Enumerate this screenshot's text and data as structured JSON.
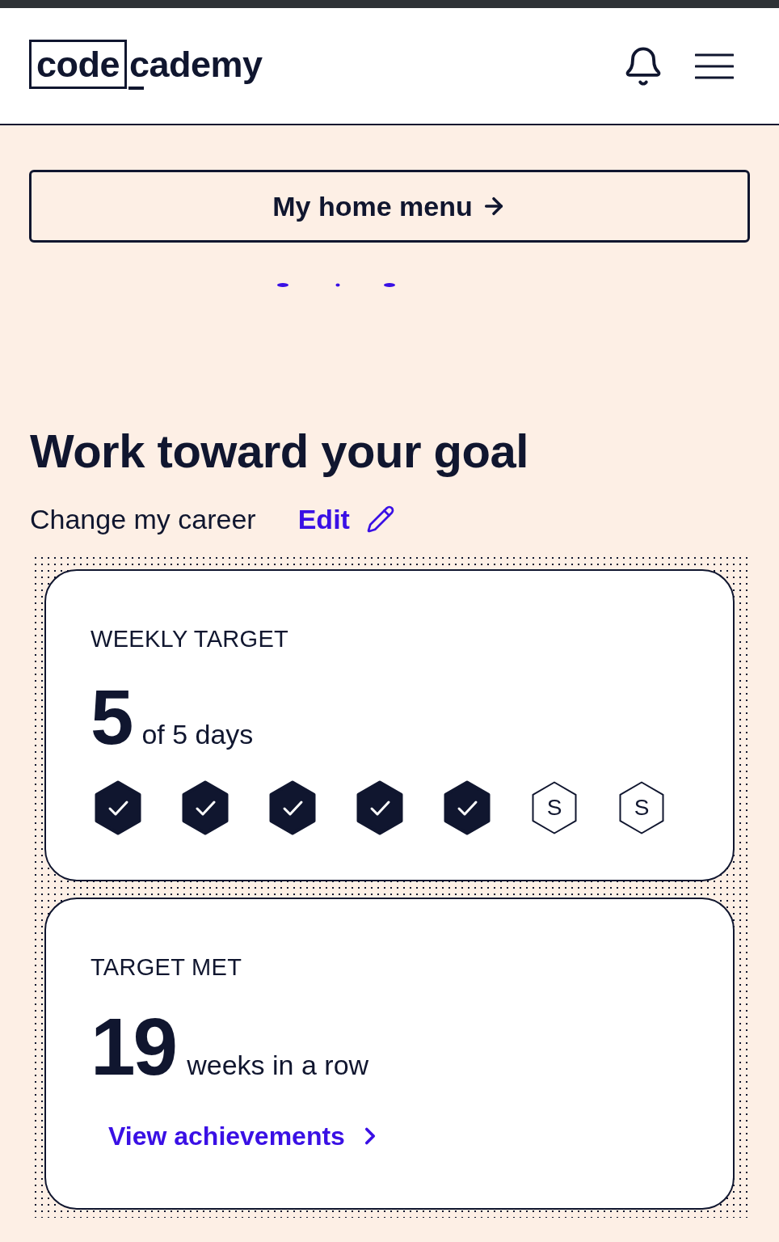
{
  "header": {
    "logo": {
      "boxed": "code",
      "rest": "cademy"
    }
  },
  "home_menu_button": {
    "label": "My home menu"
  },
  "goal": {
    "heading": "Work toward your goal",
    "goal_name": "Change my career",
    "edit_link": "Edit"
  },
  "weekly_target": {
    "title": "WEEKLY TARGET",
    "count": "5",
    "suffix": "of 5 days",
    "days": [
      {
        "completed": true
      },
      {
        "completed": true
      },
      {
        "completed": true
      },
      {
        "completed": true
      },
      {
        "completed": true
      },
      {
        "completed": false,
        "label": "S"
      },
      {
        "completed": false,
        "label": "S"
      }
    ]
  },
  "target_met": {
    "title": "TARGET MET",
    "count": "19",
    "suffix": "weeks in a row",
    "link": "View achievements"
  }
}
